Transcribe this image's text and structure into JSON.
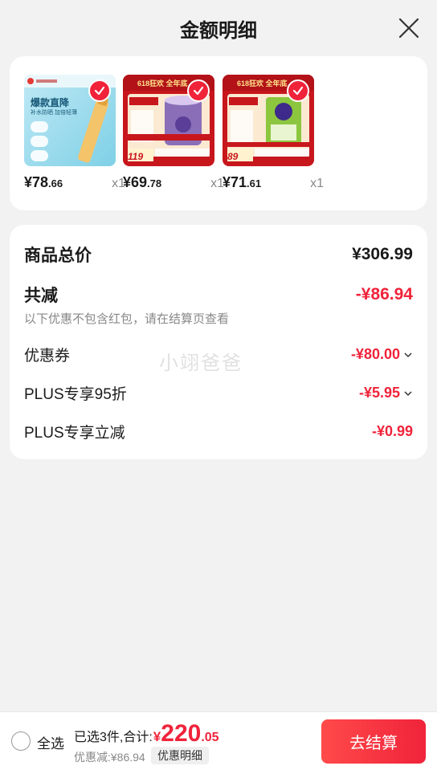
{
  "header": {
    "title": "金额明细"
  },
  "products": [
    {
      "price_int": "¥78",
      "price_dec": ".66",
      "qty": "x1",
      "theme": "sunscreen"
    },
    {
      "price_int": "¥69",
      "price_dec": ".78",
      "qty": "x1",
      "theme": "milk-powder-purple"
    },
    {
      "price_int": "¥71",
      "price_dec": ".61",
      "qty": "x1",
      "theme": "milk-powder-green"
    }
  ],
  "product_labels": {
    "p1_banner": "爆款直降",
    "p1_sub": "补水防晒 加倍轻薄",
    "p2_tag": "618狂欢 全年底",
    "p2_promo": "119",
    "p3_tag": "618狂欢 全年底",
    "p3_promo": "89"
  },
  "detail": {
    "total_label": "商品总价",
    "total_value": "¥306.99",
    "reduce_label": "共减",
    "reduce_value": "-¥86.94",
    "note": "以下优惠不包含红包，请在结算页查看",
    "items": [
      {
        "label": "优惠券",
        "value": "-¥80.00"
      },
      {
        "label": "PLUS专享95折",
        "value": "-¥5.95"
      },
      {
        "label": "PLUS专享立减",
        "value": "-¥0.99"
      }
    ]
  },
  "watermark": "小翊爸爸",
  "footer": {
    "select_all": "全选",
    "selected_text": "已选3件,合计:",
    "yen": "¥",
    "amount_int": "220",
    "amount_dec": ".05",
    "discount_text": "优惠减:¥86.94",
    "detail_button": "优惠明细",
    "checkout_button": "去结算"
  },
  "colors": {
    "accent": "#f0233a",
    "background": "#f2f2f2"
  }
}
